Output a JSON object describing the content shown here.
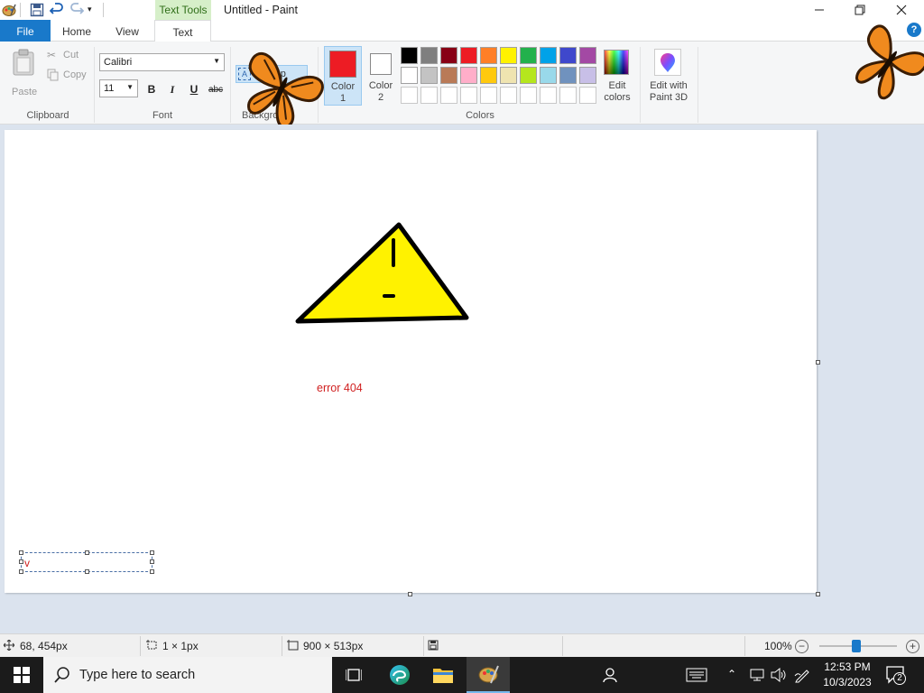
{
  "window": {
    "title": "Untitled - Paint",
    "context_tab": "Text Tools"
  },
  "tabs": {
    "file": "File",
    "home": "Home",
    "view": "View",
    "text": "Text"
  },
  "clipboard": {
    "paste": "Paste",
    "cut": "Cut",
    "copy": "Copy",
    "label": "Clipboard"
  },
  "font": {
    "family": "Calibri",
    "size": "11",
    "bold": "B",
    "italic": "I",
    "underline": "U",
    "strikethrough": "abc",
    "label": "Font"
  },
  "background": {
    "transparent_label": "Transp",
    "label": "Backgrou"
  },
  "colors": {
    "color1_label": "Color\n1",
    "color1_value": "#ed1c24",
    "color2_label": "Color\n2",
    "color2_value": "#ffffff",
    "edit_colors": "Edit\ncolors",
    "label": "Colors",
    "palette_row1": [
      "#000000",
      "#7f7f7f",
      "#880015",
      "#ed1c24",
      "#ff7f27",
      "#fff200",
      "#22b14c",
      "#00a2e8",
      "#3f48cc",
      "#a349a4"
    ],
    "palette_row2": [
      "#ffffff",
      "#c3c3c3",
      "#b97a57",
      "#ffaec9",
      "#ffc90e",
      "#efe4b0",
      "#b5e61d",
      "#99d9ea",
      "#7092be",
      "#c8bfe7"
    ],
    "palette_row3": [
      "#ffffff",
      "#ffffff",
      "#ffffff",
      "#ffffff",
      "#ffffff",
      "#ffffff",
      "#ffffff",
      "#ffffff",
      "#ffffff",
      "#ffffff"
    ]
  },
  "paint3d": {
    "label": "Edit with\nPaint 3D"
  },
  "canvas": {
    "drawn_text": "error 404",
    "textbox_text": "v"
  },
  "status": {
    "cursor_position": "68, 454px",
    "selection_size": "1 × 1px",
    "canvas_size": "900 × 513px",
    "zoom": "100%",
    "zoom_level_fraction": 0.48
  },
  "taskbar": {
    "search_placeholder": "Type here to search",
    "time": "12:53 PM",
    "date": "10/3/2023",
    "notification_count": "2"
  }
}
